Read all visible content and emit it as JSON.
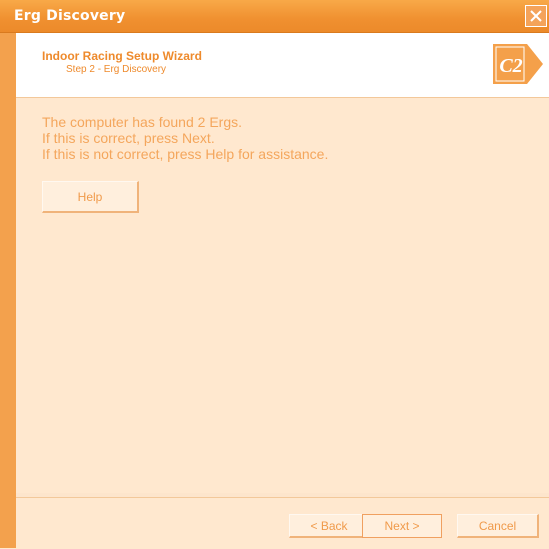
{
  "window": {
    "title": "Erg Discovery"
  },
  "header": {
    "wizard_title": "Indoor Racing Setup Wizard",
    "step": "Step 2 - Erg Discovery",
    "logo_text": "C2"
  },
  "message": {
    "line1": "The computer has found 2 Ergs.",
    "line2": "If this is correct, press Next.",
    "line3": "If this is not correct, press Help for assistance."
  },
  "buttons": {
    "help": "Help",
    "back": "< Back",
    "next": "Next >",
    "cancel": "Cancel"
  },
  "colors": {
    "accent": "#f09030",
    "text": "#f4a65c",
    "background": "#ffe8cf"
  }
}
